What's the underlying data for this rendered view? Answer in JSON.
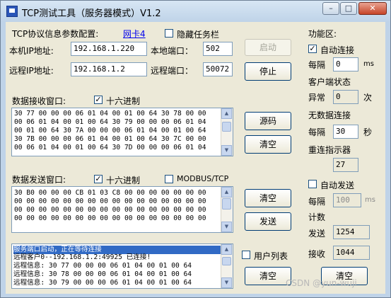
{
  "window": {
    "title": "TCP测试工具（服务器模式）V1.2",
    "controls": {
      "minimize": "–",
      "maximize": "□",
      "close": "✕"
    }
  },
  "config": {
    "title": "TCP协议信息参数配置:",
    "nic_link": "网卡4",
    "hide_taskbar_label": "隐藏任务栏",
    "local_ip_label": "本机IP地址:",
    "local_ip": "192.168.1.220",
    "local_port_label": "本地端口：",
    "local_port": "502",
    "remote_ip_label": "远程IP地址:",
    "remote_ip": "192.168.1.2",
    "remote_port_label": "远程端口：",
    "remote_port": "50072",
    "start_button": "启动",
    "stop_button": "停止"
  },
  "receive": {
    "title": "数据接收窗口:",
    "hex_label": "十六进制",
    "rows": [
      "30 77 00 00 00 06 01 04 00 01 00 64 30 78 00 00",
      "00 06 01 04 00 01 00 64 30 79 00 00 00 06 01 04",
      "00 01 00 64 30 7A 00 00 00 06 01 04 00 01 00 64",
      "30 7B 00 00 00 06 01 04 00 01 00 64 30 7C 00 00",
      "00 06 01 04 00 01 00 64 30 7D 00 00 00 06 01 04"
    ],
    "source_button": "源码",
    "clear_button": "清空"
  },
  "send": {
    "title": "数据发送窗口:",
    "hex_label": "十六进制",
    "modbus_label": "MODBUS/TCP",
    "rows": [
      "30 B0 00 00 00 CB 01 03 C8 00 00 00 00 00 00 00",
      "00 00 00 00 00 00 00 00 00 00 00 00 00 00 00 00",
      "00 00 00 00 00 00 00 00 00 00 00 00 00 00 00 00",
      "00 00 00 00 00 00 00 00 00 00 00 00 00 00 00 00"
    ],
    "clear_button": "清空",
    "send_button": "发送"
  },
  "log": {
    "rows": [
      "服务端口启动，正在等待连接",
      "远程客户0--192.168.1.2:49925 已连接!",
      "远程信息: 30 77 00 00 00 06 01 04 00 01 00 64",
      "远程信息: 30 78 00 00 00 06 01 04 00 01 00 64",
      "远程信息: 30 79 00 00 00 06 01 04 00 01 00 64"
    ],
    "user_list_label": "用户列表",
    "clear_button": "清空"
  },
  "function_panel": {
    "title": "功能区:",
    "auto_connect_label": "自动连接",
    "every1_label": "每隔",
    "every1_value": "0",
    "ms_label": "ms",
    "client_status_title": "客户端状态",
    "abnormal_label": "异常",
    "abnormal_value": "0",
    "times_label": "次",
    "no_data_title": "无数据连接",
    "every2_label": "每隔",
    "every2_value": "30",
    "seconds_label": "秒",
    "reconnect_title": "重连指示器",
    "reconnect_value": "27",
    "auto_send_label": "自动发送",
    "every3_label": "每隔",
    "every3_value": "100",
    "ms2_label": "ms",
    "count_title": "计数",
    "send_label": "发送",
    "send_value": "1254",
    "recv_label": "接收",
    "recv_value": "1044",
    "clear_button": "清空"
  },
  "watermark": "CSDN @yun-wuji",
  "colors": {
    "title_bar": "#bfd3e8",
    "client_bg": "#ece9d8",
    "selection": "#316ac5",
    "close_button": "#c64428"
  }
}
